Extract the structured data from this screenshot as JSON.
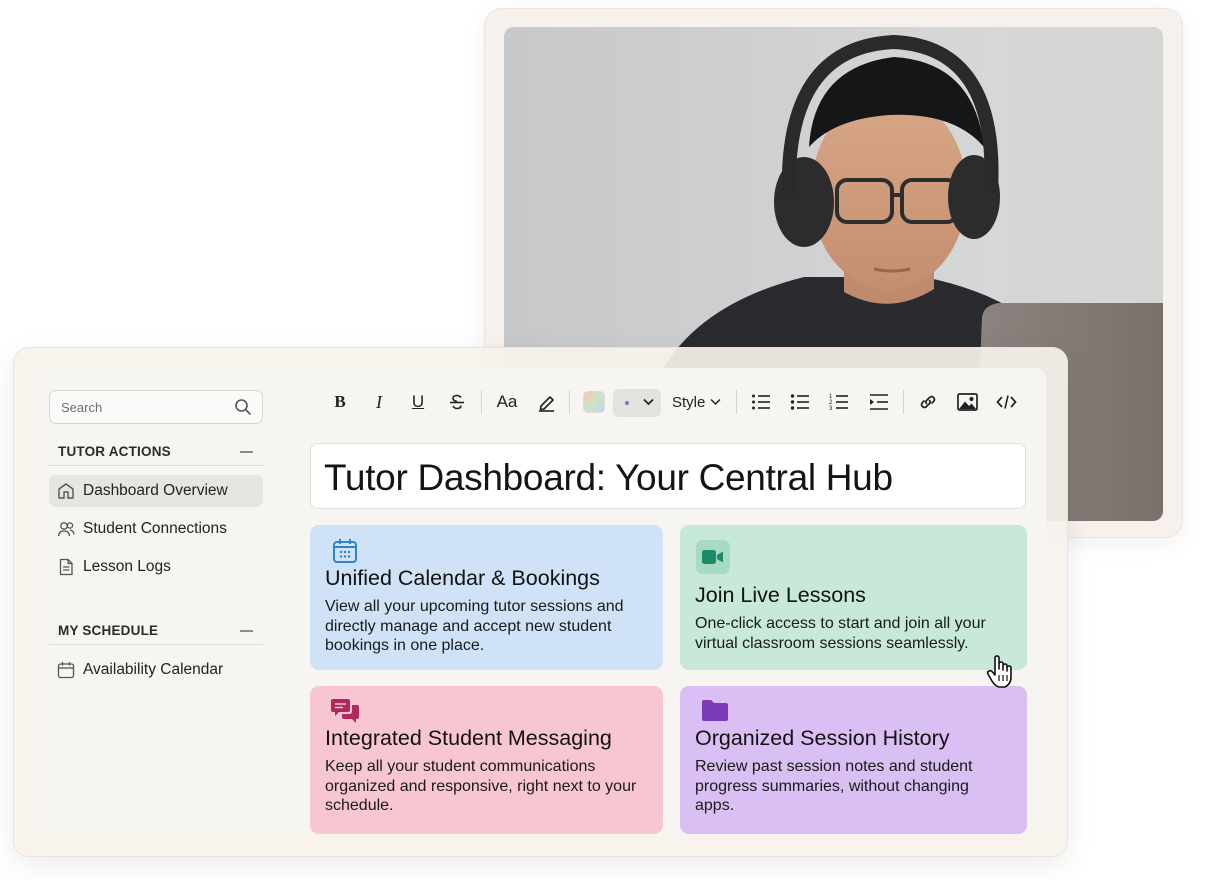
{
  "sidebar": {
    "search_placeholder": "Search",
    "sections": [
      {
        "title": "TUTOR ACTIONS",
        "items": [
          {
            "label": "Dashboard Overview",
            "icon": "home-icon",
            "active": true
          },
          {
            "label": "Student Connections",
            "icon": "users-icon",
            "active": false
          },
          {
            "label": "Lesson Logs",
            "icon": "document-icon",
            "active": false
          }
        ]
      },
      {
        "title": "MY SCHEDULE",
        "items": [
          {
            "label": "Availability Calendar",
            "icon": "calendar-icon",
            "active": false
          }
        ]
      }
    ]
  },
  "toolbar": {
    "bold": "B",
    "italic": "I",
    "underline": "U",
    "font_size": "Aa",
    "style_label": "Style",
    "icons": [
      "bold-icon",
      "italic-icon",
      "underline-icon",
      "strikethrough-icon",
      "font-size-icon",
      "highlighter-icon",
      "color-swatch",
      "highlight-select",
      "style-dropdown",
      "bullet-list-icon",
      "checklist-icon",
      "numbered-list-icon",
      "indent-icon",
      "link-icon",
      "image-icon",
      "code-icon"
    ]
  },
  "main": {
    "title": "Tutor Dashboard: Your Central Hub",
    "cards": [
      {
        "title": "Unified Calendar & Bookings",
        "body": "View all your upcoming tutor sessions and directly manage and accept new student bookings in one place.",
        "icon": "calendar-icon",
        "color": "#cfe2f8",
        "icon_color": "#2f84c4"
      },
      {
        "title": "Join Live Lessons",
        "body": "One-click access to start and join all your virtual classroom sessions seamlessly.",
        "icon": "video-camera-icon",
        "color": "#c8e8d9",
        "icon_color": "#1f8a6a"
      },
      {
        "title": "Integrated Student Messaging",
        "body": "Keep all your student communications organized and responsive, right next to your schedule.",
        "icon": "chat-bubbles-icon",
        "color": "#f8c6d3",
        "icon_color": "#b0285d"
      },
      {
        "title": "Organized Session History",
        "body": "Review past session notes and student progress summaries, without changing apps.",
        "icon": "folder-icon",
        "color": "#d9bff3",
        "icon_color": "#7b3bb8"
      }
    ]
  },
  "photo": {
    "subject": "student-with-headphones-photo"
  }
}
